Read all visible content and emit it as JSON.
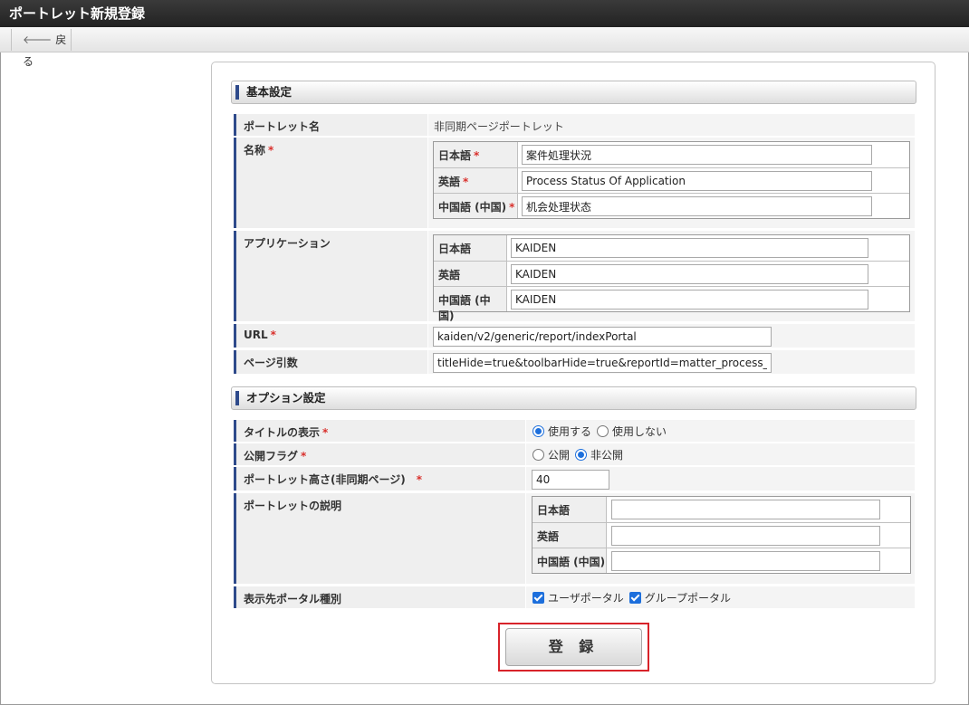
{
  "window": {
    "title": "ポートレット新規登録"
  },
  "toolbar": {
    "back_label": "戻る"
  },
  "basic": {
    "heading": "基本設定",
    "portlet_name": {
      "label": "ポートレット名",
      "value": "非同期ページポートレット"
    },
    "name": {
      "label": "名称",
      "rows": [
        {
          "label": "日本語",
          "value": "案件処理状況"
        },
        {
          "label": "英語",
          "value": "Process Status Of Application"
        },
        {
          "label": "中国語 (中国)",
          "value": "机会处理状态"
        }
      ]
    },
    "application": {
      "label": "アプリケーション",
      "rows": [
        {
          "label": "日本語",
          "value": "KAIDEN"
        },
        {
          "label": "英語",
          "value": "KAIDEN"
        },
        {
          "label": "中国語 (中国)",
          "value": "KAIDEN"
        }
      ]
    },
    "url": {
      "label": "URL",
      "value": "kaiden/v2/generic/report/indexPortal"
    },
    "page_args": {
      "label": "ページ引数",
      "value": "titleHide=true&toolbarHide=true&reportId=matter_process_info"
    }
  },
  "options": {
    "heading": "オプション設定",
    "title_display": {
      "label": "タイトルの表示",
      "opt_use": "使用する",
      "opt_nouse": "使用しない",
      "selected": "使用する"
    },
    "public_flag": {
      "label": "公開フラグ",
      "opt_public": "公開",
      "opt_private": "非公開",
      "selected": "非公開"
    },
    "height": {
      "label": "ポートレット高さ(非同期ページ)",
      "value": "40"
    },
    "description": {
      "label": "ポートレットの説明",
      "rows": [
        {
          "label": "日本語",
          "value": ""
        },
        {
          "label": "英語",
          "value": ""
        },
        {
          "label": "中国語 (中国)",
          "value": ""
        }
      ]
    },
    "portal_type": {
      "label": "表示先ポータル種別",
      "opt_user": "ユーザポータル",
      "opt_group": "グループポータル"
    }
  },
  "register_label": "登 録",
  "colors": {
    "accent": "#2e4a8b",
    "required": "#d9302c",
    "control": "#1d6fdc",
    "highlight": "#d8232a"
  },
  "icons": {
    "back": "left-arrow-icon"
  }
}
